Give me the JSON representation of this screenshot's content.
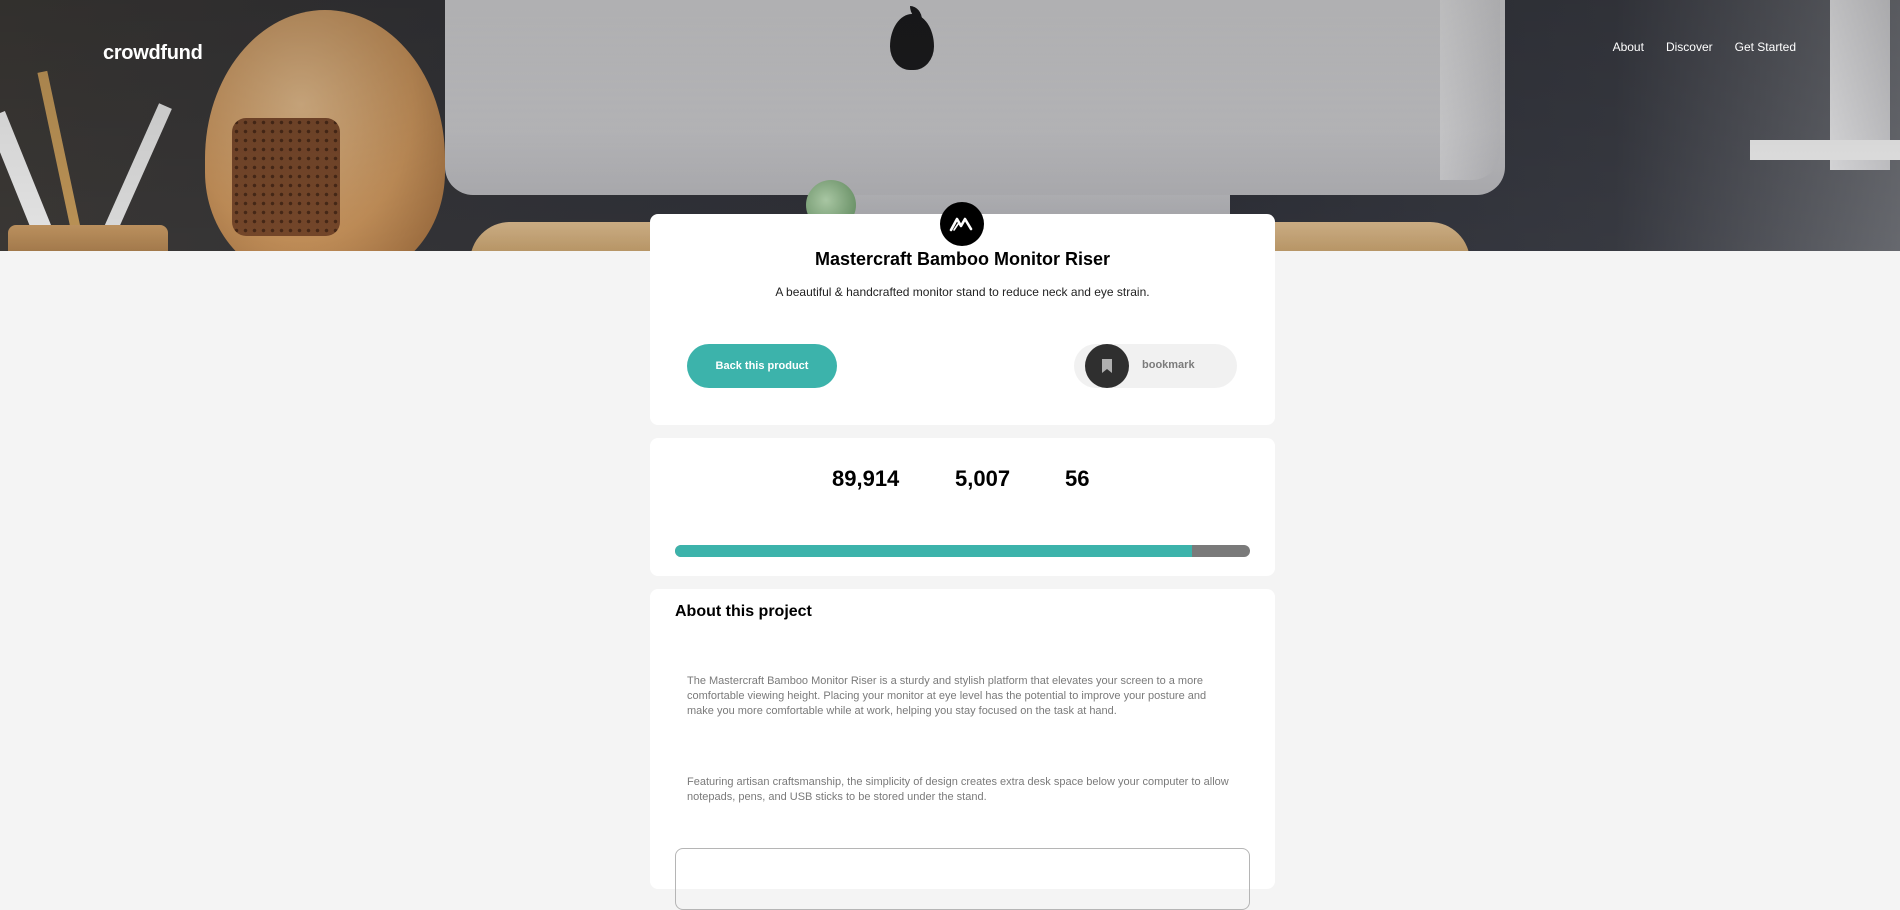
{
  "header": {
    "logo": "crowdfund",
    "nav": [
      "About",
      "Discover",
      "Get Started"
    ]
  },
  "project": {
    "title": "Mastercraft Bamboo Monitor Riser",
    "tagline": "A beautiful & handcrafted monitor stand to reduce neck and eye strain.",
    "back_label": "Back this product",
    "bookmark_label": "bookmark"
  },
  "stats": {
    "values": [
      "89,914",
      "5,007",
      "56"
    ],
    "progress_fraction": 0.899
  },
  "about": {
    "title": "About this project",
    "paragraphs": [
      "The Mastercraft Bamboo Monitor Riser is a sturdy and stylish platform that elevates your screen to a more comfortable viewing height. Placing your monitor at eye level has the potential to improve your posture and make you more comfortable while at work, helping you stay focused on the task at hand.",
      "Featuring artisan craftsmanship, the simplicity of design creates extra desk space below your computer to allow notepads, pens, and USB sticks to be stored under the stand."
    ]
  },
  "colors": {
    "accent": "#3cb3ab",
    "progress_track": "#7a7a7a",
    "background": "#f4f4f4",
    "dark": "#2f2f2f"
  },
  "icons": {
    "product_logo": "mastercraft-logo-icon",
    "bookmark": "bookmark-icon"
  }
}
